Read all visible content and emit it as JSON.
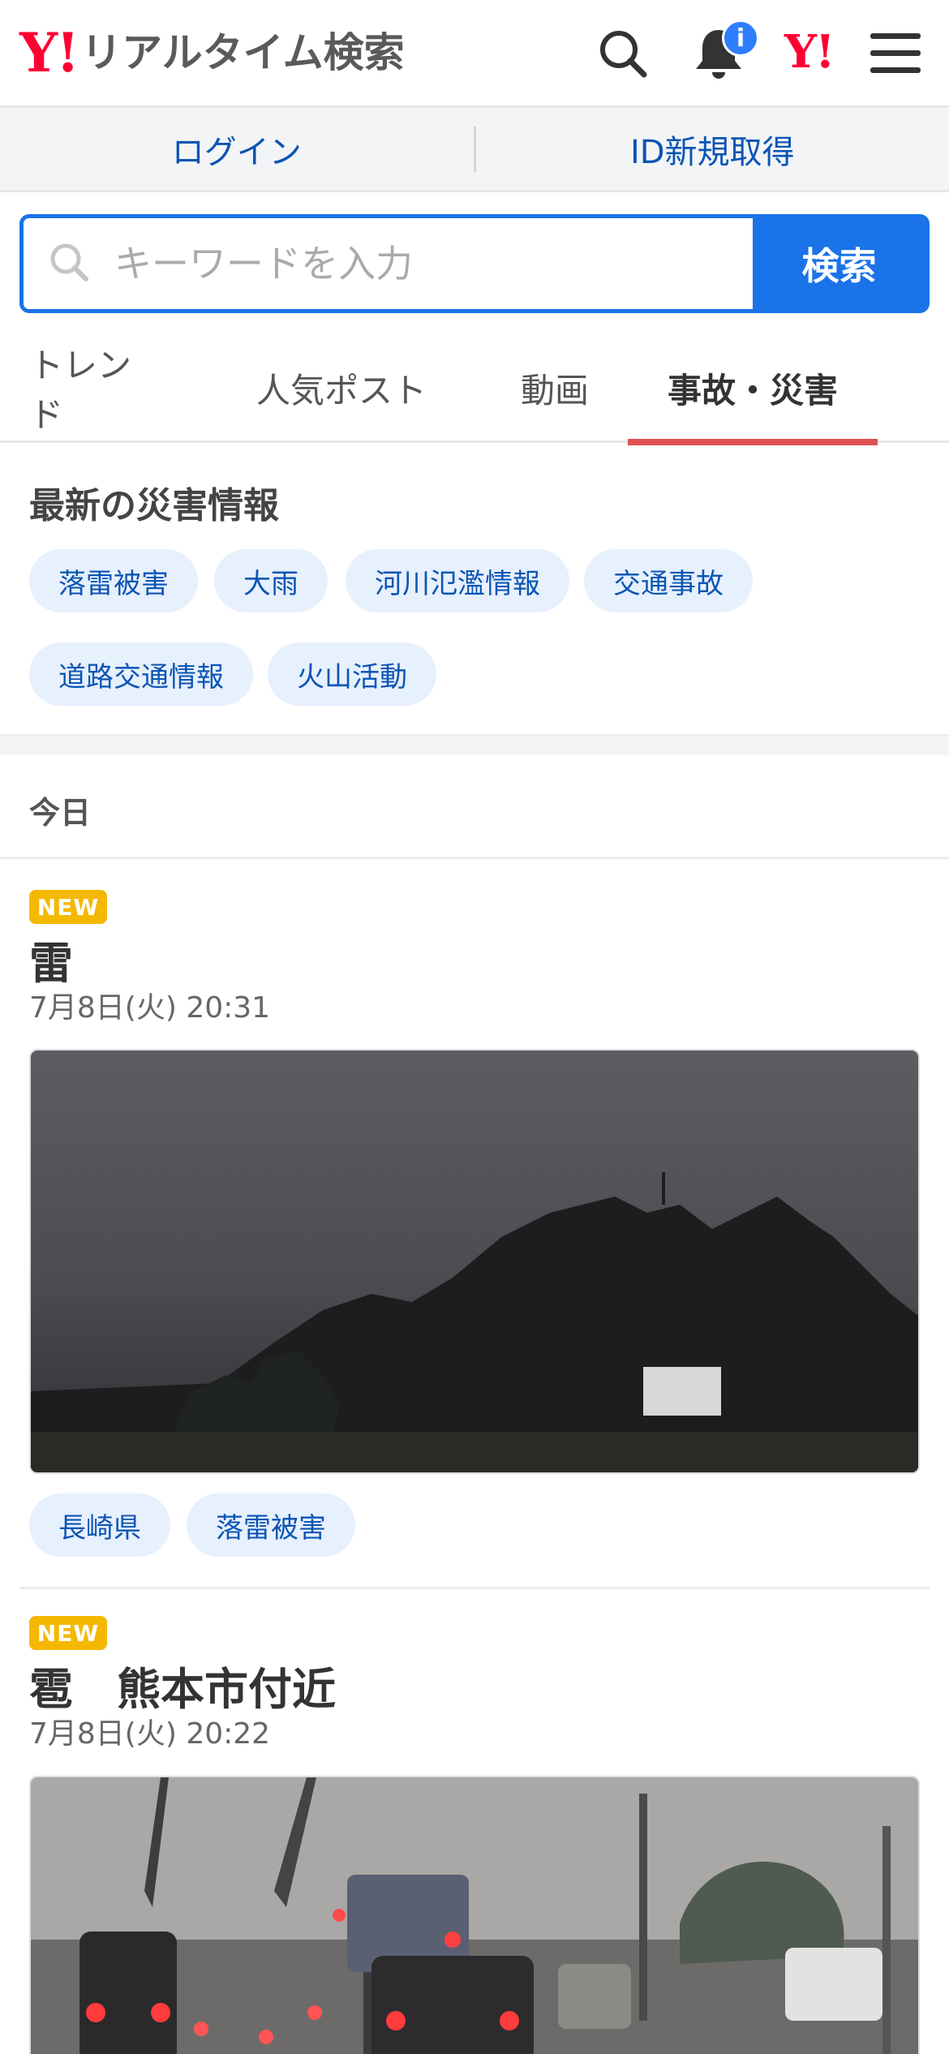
{
  "header": {
    "logo_mark": "Y!",
    "logo_title": "リアルタイム検索",
    "notification_badge": "i",
    "yahoo_mark": "Y!"
  },
  "auth": {
    "login": "ログイン",
    "register": "ID新規取得"
  },
  "search": {
    "placeholder": "キーワードを入力",
    "button": "検索"
  },
  "tabs": [
    {
      "label": "トレンド",
      "active": false
    },
    {
      "label": "人気ポスト",
      "active": false
    },
    {
      "label": "動画",
      "active": false
    },
    {
      "label": "事故・災害",
      "active": true
    }
  ],
  "disaster_section": {
    "title": "最新の災害情報",
    "chips": [
      "落雷被害",
      "大雨",
      "河川氾濫情報",
      "交通事故",
      "道路交通情報",
      "火山活動"
    ]
  },
  "timeline": {
    "day_label": "今日"
  },
  "posts": [
    {
      "badge": "NEW",
      "title": "雷",
      "date": "7月8日(火) 20:31",
      "tags": [
        "長崎県",
        "落雷被害"
      ]
    },
    {
      "badge": "NEW",
      "title": "雹　熊本市付近",
      "date": "7月8日(火) 20:22",
      "tags": []
    }
  ],
  "colors": {
    "accent_blue": "#1a73e8",
    "link_blue": "#0a55b4",
    "active_tab_underline": "#e05252",
    "new_badge": "#f5b800",
    "yahoo_red": "#ff0033"
  }
}
